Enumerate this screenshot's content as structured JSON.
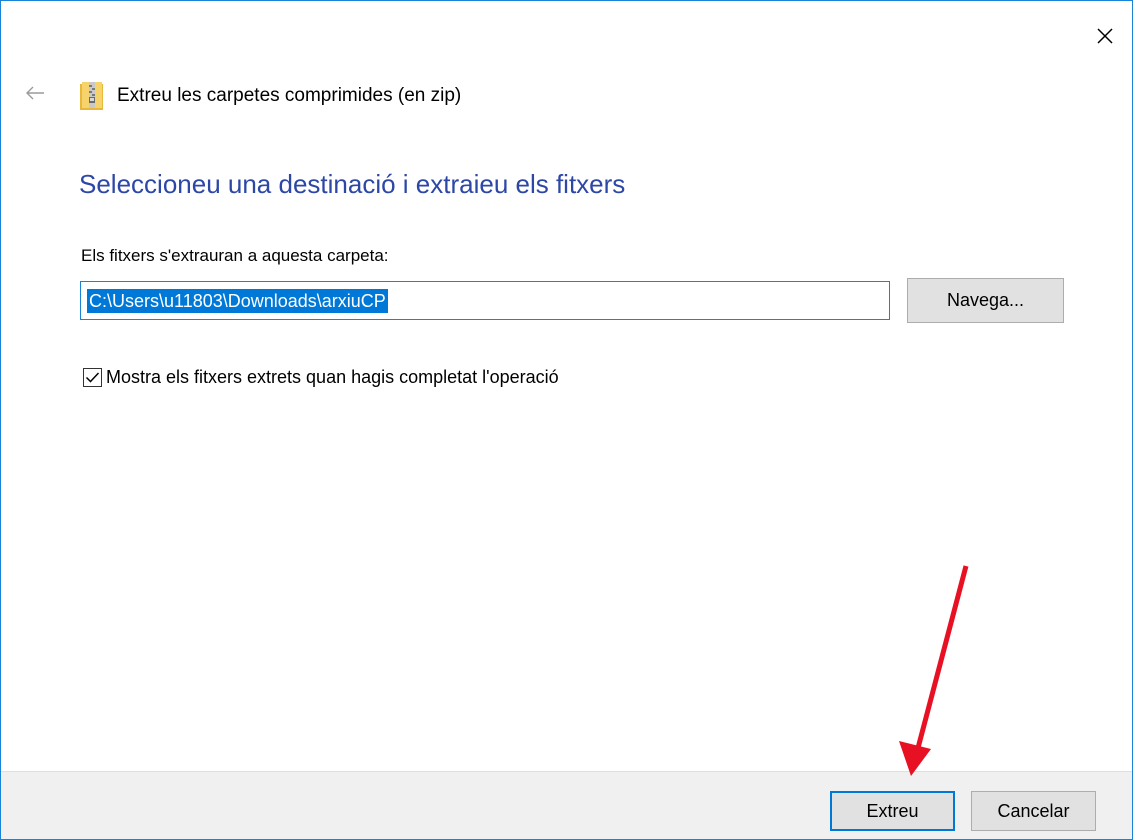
{
  "window": {
    "title": "Extreu les carpetes comprimides (en zip)",
    "close_icon": "close-icon",
    "back_icon": "back-arrow-icon",
    "title_icon": "zip-folder-icon"
  },
  "main": {
    "heading": "Seleccioneu una destinació i extraieu els fitxers",
    "destination_label": "Els fitxers s'extrauran a aquesta carpeta:",
    "destination_path": "C:\\Users\\u11803\\Downloads\\arxiuCP",
    "browse_label": "Navega...",
    "show_files_label": "Mostra els fitxers extrets quan hagis completat l'operació",
    "show_files_checked": true
  },
  "footer": {
    "extract_label": "Extreu",
    "cancel_label": "Cancelar"
  },
  "colors": {
    "accent": "#0078d7",
    "heading": "#2c47a6",
    "annotation": "#e81123"
  }
}
